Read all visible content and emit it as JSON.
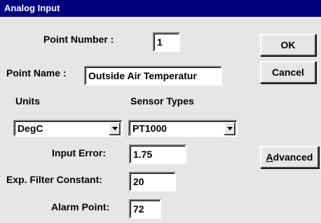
{
  "window": {
    "title": "Analog Input"
  },
  "labels": {
    "point_number": "Point Number :",
    "point_name": "Point Name :",
    "units": "Units",
    "sensor_types": "Sensor Types",
    "input_error": "Input Error:",
    "exp_filter_constant": "Exp. Filter Constant:",
    "alarm_point": "Alarm Point:"
  },
  "fields": {
    "point_number": "1",
    "point_name": "Outside Air Temperatur",
    "units": "DegC",
    "sensor_type": "PT1000",
    "input_error": "1.75",
    "exp_filter_constant": "20",
    "alarm_point": "72"
  },
  "buttons": {
    "ok": "OK",
    "cancel": "Cancel",
    "advanced_mnemonic": "A",
    "advanced_rest": "dvanced"
  },
  "colors": {
    "titlebar": "#00007f",
    "dialog_bg": "#e6e6e6"
  }
}
